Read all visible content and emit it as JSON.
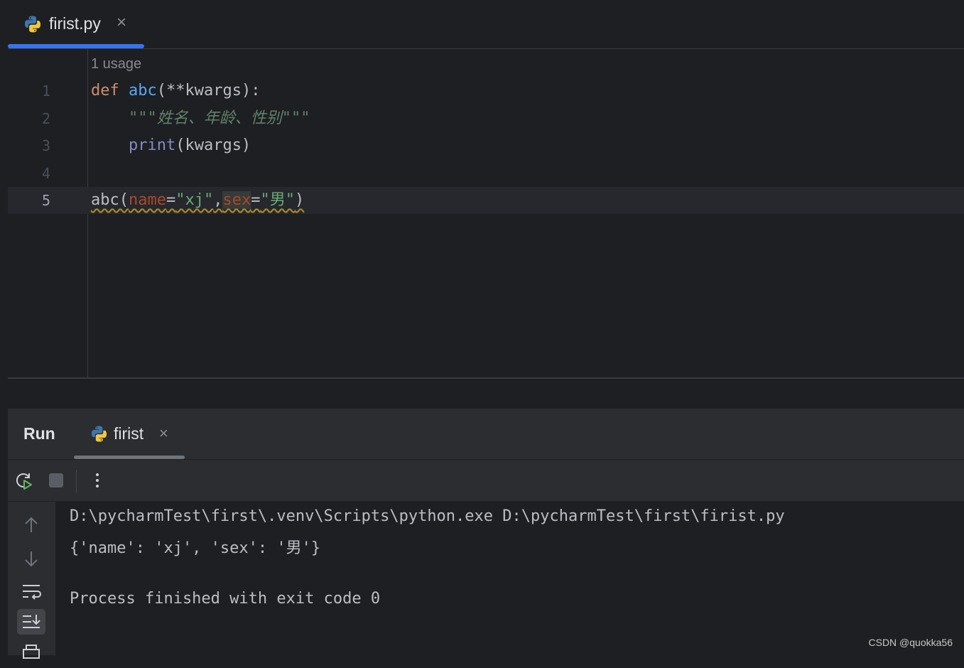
{
  "editor_tab": {
    "title": "firist.py",
    "close": "×"
  },
  "editor": {
    "usage_hint": "1 usage",
    "line_numbers": [
      "1",
      "2",
      "3",
      "4",
      "5"
    ],
    "line1": {
      "kw": "def",
      "fn": "abc",
      "rest": "(**kwargs):"
    },
    "line2": {
      "indent": "    ",
      "docstring": "\"\"\"姓名、年龄、性别\"\"\""
    },
    "line3": {
      "indent": "    ",
      "builtin": "print",
      "rest": "(kwargs)"
    },
    "line5": {
      "call": "abc(",
      "p1": "name",
      "eq1": "=",
      "s1": "\"xj\"",
      "comma": ",",
      "p2": "sex",
      "eq2": "=",
      "s2": "\"男\"",
      "close": ")"
    }
  },
  "run_panel": {
    "label": "Run",
    "tab_title": "firist",
    "close": "×"
  },
  "console": {
    "lines": [
      "D:\\pycharmTest\\first\\.venv\\Scripts\\python.exe D:\\pycharmTest\\first\\firist.py",
      "{'name': 'xj', 'sex': '男'}",
      "",
      "Process finished with exit code 0"
    ]
  },
  "watermark": "CSDN @quokka56",
  "colors": {
    "accent": "#3574f0",
    "keyword": "#cf8e6d",
    "function": "#56a8f5",
    "string": "#6aab73",
    "param": "#aa4926"
  }
}
